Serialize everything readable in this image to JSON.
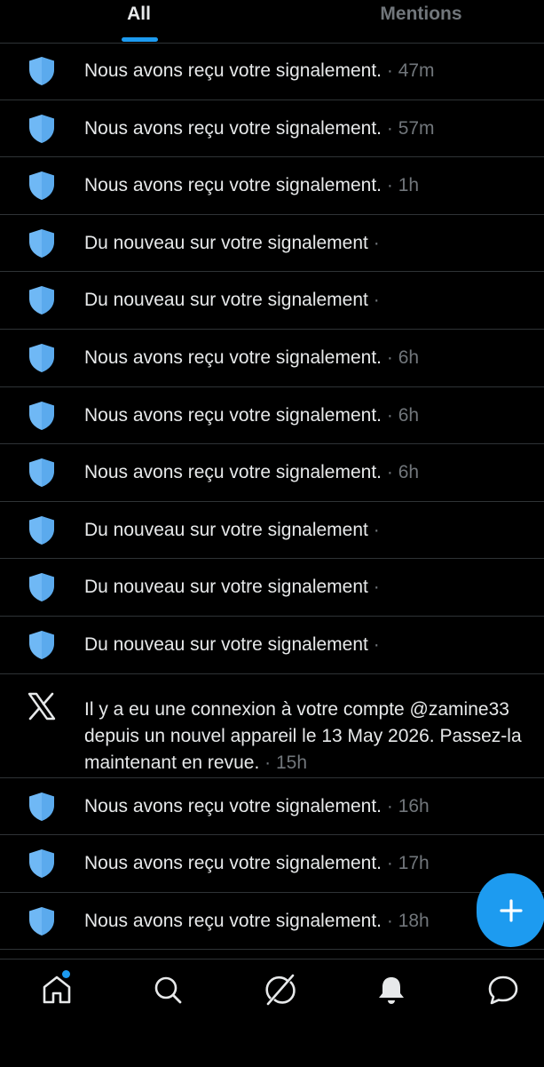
{
  "tabs": {
    "all": "All",
    "mentions": "Mentions"
  },
  "notifications": [
    {
      "icon": "shield-icon",
      "text": "Nous avons reçu votre signalement.",
      "time": "47m"
    },
    {
      "icon": "shield-icon",
      "text": "Nous avons reçu votre signalement.",
      "time": "57m"
    },
    {
      "icon": "shield-icon",
      "text": "Nous avons reçu votre signalement.",
      "time": "1h"
    },
    {
      "icon": "shield-icon",
      "text": "Du nouveau sur votre signalement",
      "time": ""
    },
    {
      "icon": "shield-icon",
      "text": "Du nouveau sur votre signalement",
      "time": ""
    },
    {
      "icon": "shield-icon",
      "text": "Nous avons reçu votre signalement.",
      "time": "6h"
    },
    {
      "icon": "shield-icon",
      "text": "Nous avons reçu votre signalement.",
      "time": "6h"
    },
    {
      "icon": "shield-icon",
      "text": "Nous avons reçu votre signalement.",
      "time": "6h"
    },
    {
      "icon": "shield-icon",
      "text": "Du nouveau sur votre signalement",
      "time": ""
    },
    {
      "icon": "shield-icon",
      "text": "Du nouveau sur votre signalement",
      "time": ""
    },
    {
      "icon": "shield-icon",
      "text": "Du nouveau sur votre signalement",
      "time": ""
    },
    {
      "icon": "x-logo-icon",
      "text": "Il y a eu une connexion à votre compte @zamine33 depuis un nouvel appareil le 13 May 2026. Passez-la maintenant en revue.",
      "time": "15h"
    },
    {
      "icon": "shield-icon",
      "text": "Nous avons reçu votre signalement.",
      "time": "16h"
    },
    {
      "icon": "shield-icon",
      "text": "Nous avons reçu votre signalement.",
      "time": "17h"
    },
    {
      "icon": "shield-icon",
      "text": "Nous avons reçu votre signalement.",
      "time": "18h"
    }
  ],
  "separator": "·",
  "fab": {
    "icon": "plus-icon"
  },
  "bottom_nav": [
    {
      "name": "home-icon",
      "has_dot": true
    },
    {
      "name": "search-icon",
      "has_dot": false
    },
    {
      "name": "grok-icon",
      "has_dot": false
    },
    {
      "name": "bell-icon",
      "has_dot": false
    },
    {
      "name": "messages-icon",
      "has_dot": false
    }
  ],
  "colors": {
    "accent": "#1d9bf0",
    "shield": "#6fb8f5",
    "background": "#000000",
    "muted": "#71767b"
  }
}
